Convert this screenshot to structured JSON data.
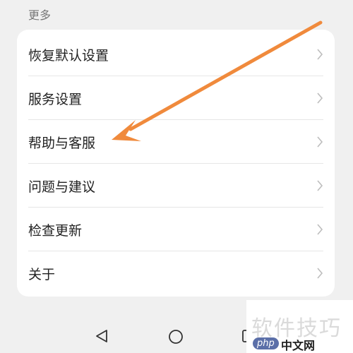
{
  "section": {
    "title": "更多"
  },
  "menu": {
    "items": [
      {
        "label": "恢复默认设置"
      },
      {
        "label": "服务设置"
      },
      {
        "label": "帮助与客服"
      },
      {
        "label": "问题与建议"
      },
      {
        "label": "检查更新"
      },
      {
        "label": "关于"
      }
    ]
  },
  "nav": {
    "back": "back-triangle-icon",
    "home": "home-circle-icon",
    "recent": "recent-square-icon"
  },
  "annotation": {
    "arrow_color": "#f08a3c"
  },
  "watermark": {
    "text": "软件技巧",
    "logo_tag": "php",
    "logo_site": "中文网"
  }
}
